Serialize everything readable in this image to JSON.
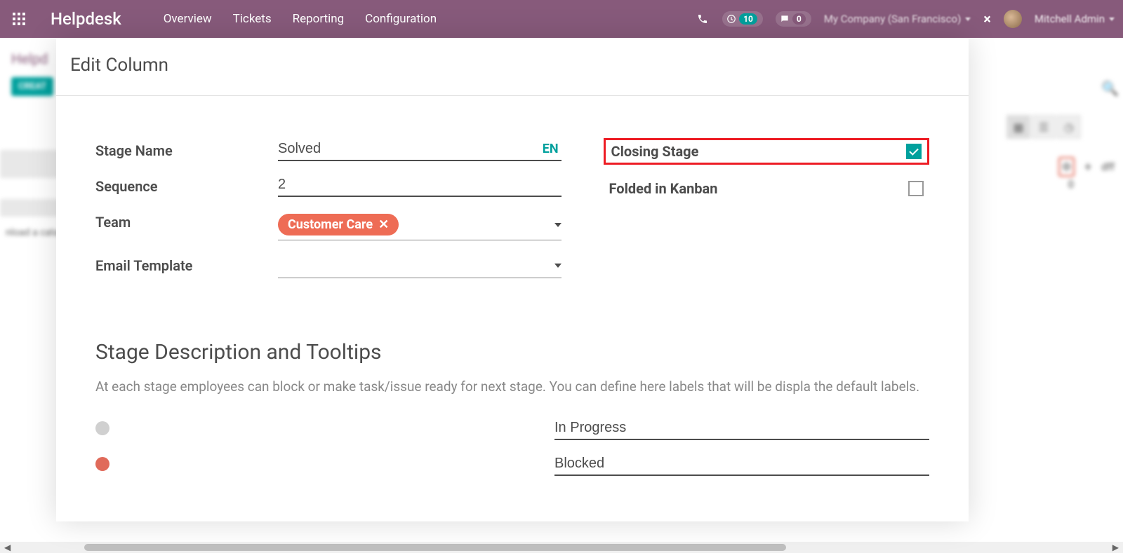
{
  "topnav": {
    "brand": "Helpdesk",
    "menu": [
      "Overview",
      "Tickets",
      "Reporting",
      "Configuration"
    ],
    "activity_count": "10",
    "message_count": "0",
    "company": "My Company (San Francisco)",
    "user": "Mitchell Admin"
  },
  "bg": {
    "breadcrumb": "Helpd",
    "create": "CREAT",
    "load_msg": "nload a cata",
    "col_name": "dff",
    "col_count": "0"
  },
  "modal": {
    "title": "Edit Column",
    "fields": {
      "stage_name_label": "Stage Name",
      "stage_name_value": "Solved",
      "lang_btn": "EN",
      "sequence_label": "Sequence",
      "sequence_value": "2",
      "team_label": "Team",
      "team_tag": "Customer Care",
      "email_template_label": "Email Template",
      "email_template_value": "",
      "closing_label": "Closing Stage",
      "closing_checked": true,
      "folded_label": "Folded in Kanban",
      "folded_checked": false
    },
    "section": {
      "heading": "Stage Description and Tooltips",
      "desc": "At each stage employees can block or make task/issue ready for next stage. You can define here labels that will be displa the default labels.",
      "status_green": "In Progress",
      "status_red": "Blocked"
    }
  }
}
